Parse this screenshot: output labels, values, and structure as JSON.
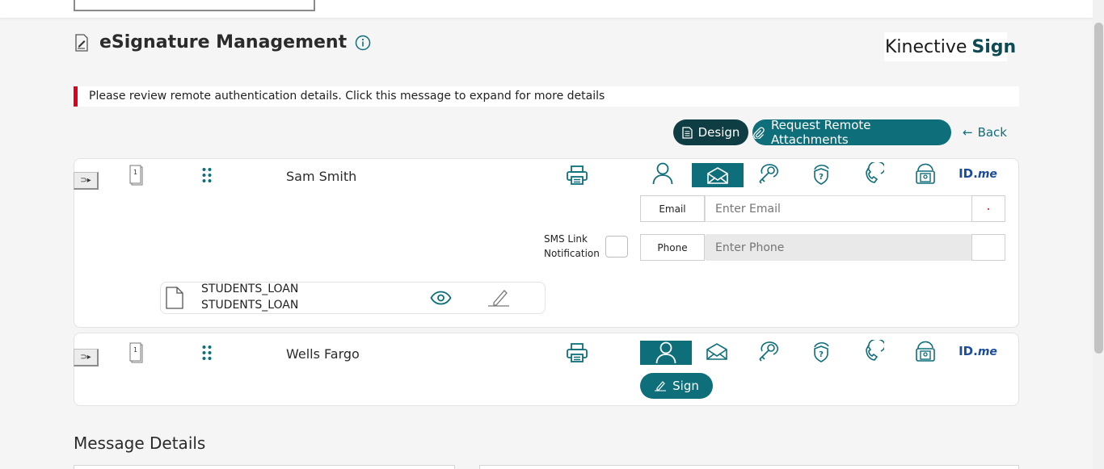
{
  "page": {
    "title": "eSignature Management",
    "brand_prefix": "Kinective",
    "brand_suffix": "Sign",
    "alert_message": "Please review remote authentication details. Click this message to expand for more details"
  },
  "toolbar": {
    "design_label": "Design",
    "remote_label": "Request Remote Attachments",
    "back_label": "Back"
  },
  "signers": [
    {
      "name": "Sam Smith",
      "page_count": "1",
      "active_auth": "email-icon",
      "email_label": "Email",
      "email_placeholder": "Enter Email",
      "phone_label": "Phone",
      "phone_placeholder": "Enter Phone",
      "sms_label_1": "SMS Link",
      "sms_label_2": "Notification",
      "document_line_1": "STUDENTS_LOAN",
      "document_line_2": "STUDENTS_LOAN"
    },
    {
      "name": "Wells Fargo",
      "page_count": "1",
      "active_auth": "in-person-icon",
      "sign_label": "Sign"
    }
  ],
  "auth_methods": [
    "in-person-icon",
    "email-icon",
    "kba-key-icon",
    "shield-question-icon",
    "phone-icon",
    "id-scan-icon",
    "idme-icon"
  ],
  "idme": {
    "id": "ID.",
    "me": "me"
  },
  "sections": {
    "message_details": "Message Details"
  },
  "colors": {
    "primary": "#0e6f7a",
    "dark": "#0e3e44",
    "alert": "#e0001b",
    "idme": "#1a4c9c"
  }
}
